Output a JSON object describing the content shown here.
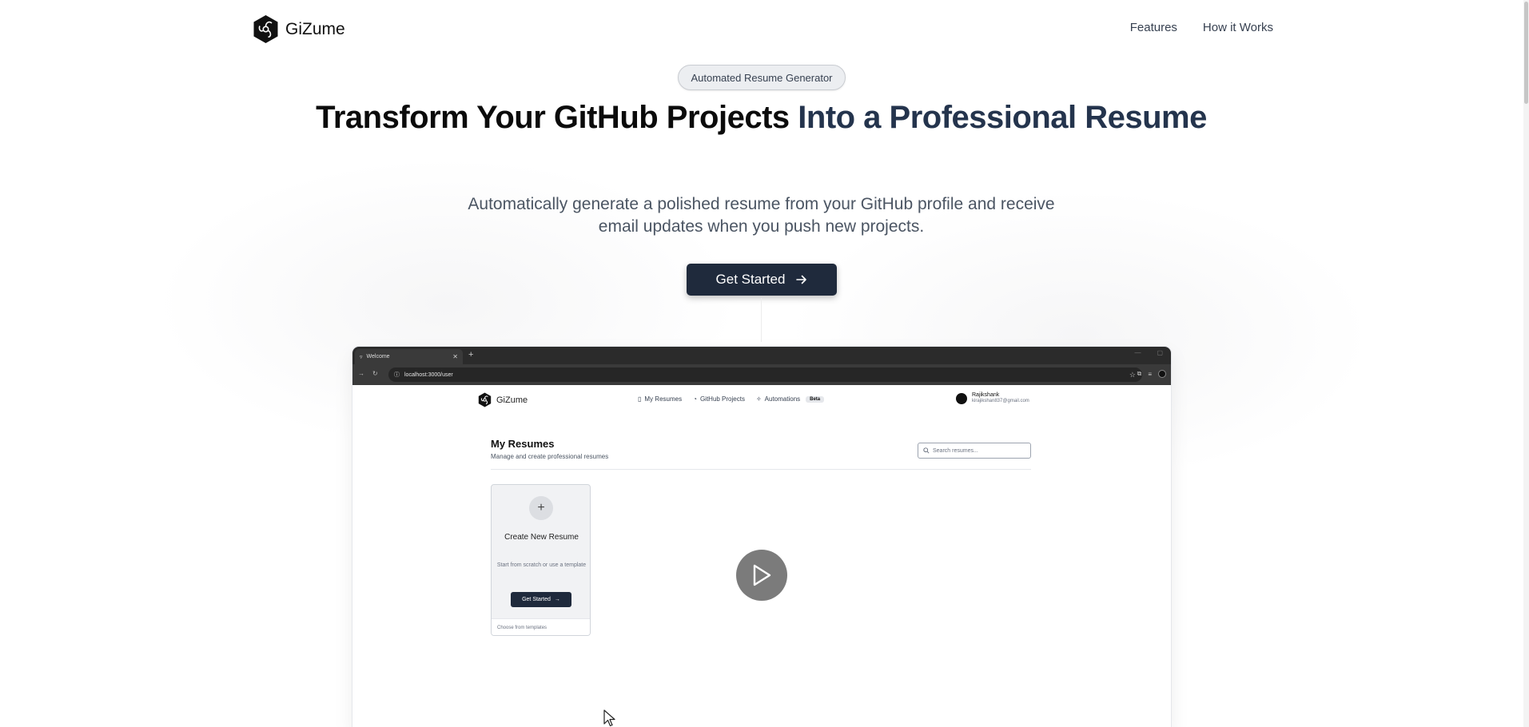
{
  "header": {
    "logo_text": "GiZume",
    "nav": [
      {
        "label": "Features"
      },
      {
        "label": "How it Works"
      }
    ]
  },
  "hero": {
    "badge": "Automated Resume Generator",
    "headline_main": "Transform Your GitHub Projects ",
    "headline_accent": "Into a Professional Resume",
    "subtitle": "Automatically generate a polished resume from your GitHub profile and receive email updates when you push new projects.",
    "cta_label": "Get Started"
  },
  "embedded_browser": {
    "tab_title": "Welcome",
    "url": "localhost:3000/user",
    "app": {
      "logo_text": "GiZume",
      "nav": [
        {
          "label": "My Resumes",
          "icon": "file-icon"
        },
        {
          "label": "GitHub Projects",
          "icon": "github-icon"
        },
        {
          "label": "Automations",
          "icon": "sparkle-icon"
        }
      ],
      "beta_badge": "Beta",
      "user": {
        "name": "Rajikshank",
        "email": "kirajikshan837@gmail.com"
      },
      "title": "My Resumes",
      "subtitle": "Manage and create professional resumes",
      "search_placeholder": "Search resumes...",
      "card": {
        "title": "Create New Resume",
        "description": "Start from scratch or use a template",
        "button": "Get Started",
        "footer": "Choose from templates"
      }
    }
  },
  "colors": {
    "primary": "#1f2a3c",
    "accent_text": "#24344d",
    "body_text": "#4b5563"
  }
}
